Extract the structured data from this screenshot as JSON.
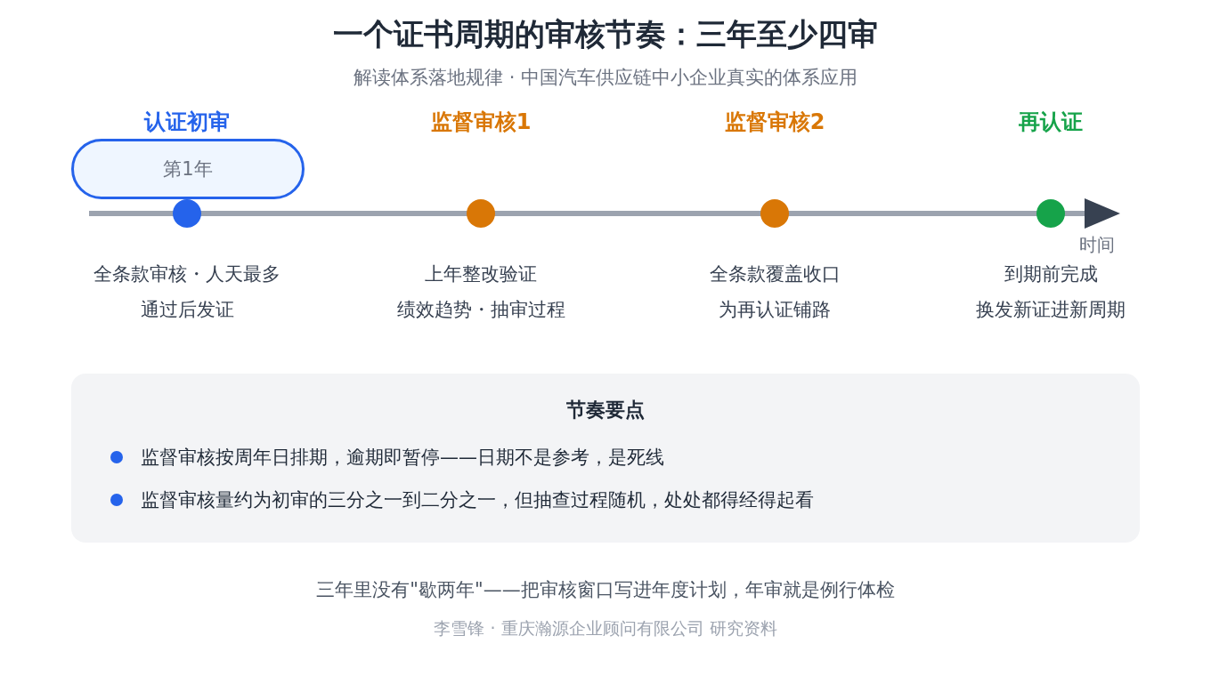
{
  "title": "一个证书周期的审核节奏：三年至少四审",
  "subtitle": "解读体系落地规律 · 中国汽车供应链中小企业真实的体系应用",
  "timeline": {
    "axis_label": "时间",
    "milestones": [
      {
        "title": "认证初审",
        "color": "#2563eb",
        "badge": "第1年",
        "lines": [
          "全条款审核・人天最多",
          "通过后发证"
        ]
      },
      {
        "title": "监督审核1",
        "color": "#d97706",
        "lines": [
          "上年整改验证",
          "绩效趋势・抽审过程"
        ]
      },
      {
        "title": "监督审核2",
        "color": "#d97706",
        "lines": [
          "全条款覆盖收口",
          "为再认证铺路"
        ]
      },
      {
        "title": "再认证",
        "color": "#16a34a",
        "lines": [
          "到期前完成",
          "换发新证进新周期"
        ]
      }
    ]
  },
  "key_points": {
    "title": "节奏要点",
    "items": [
      "监督审核按周年日排期，逾期即暂停——日期不是参考，是死线",
      "监督审核量约为初审的三分之一到二分之一，但抽查过程随机，处处都得经得起看"
    ]
  },
  "footer": {
    "note": "三年里没有\"歇两年\"——把审核窗口写进年度计划，年审就是例行体检",
    "credit": "李雪锋 · 重庆瀚源企业顾问有限公司 研究资料"
  }
}
